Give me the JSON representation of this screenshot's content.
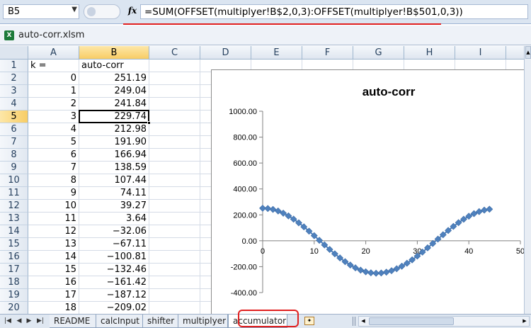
{
  "formula_bar": {
    "name_box": "B5",
    "fx_label": "fx",
    "formula": "=SUM(OFFSET(multiplyer!B$2,0,3):OFFSET(multiplyer!B$501,0,3))"
  },
  "workbook": {
    "title": "auto-corr.xlsm"
  },
  "columns": [
    "A",
    "B",
    "C",
    "D",
    "E",
    "F",
    "G",
    "H",
    "I"
  ],
  "selected": {
    "column": "B",
    "row": "5"
  },
  "header_row": {
    "row": "1",
    "a": "k =",
    "b": "auto-corr"
  },
  "rows": [
    {
      "row": "2",
      "k": "0",
      "v": "251.19"
    },
    {
      "row": "3",
      "k": "1",
      "v": "249.04"
    },
    {
      "row": "4",
      "k": "2",
      "v": "241.84"
    },
    {
      "row": "5",
      "k": "3",
      "v": "229.74"
    },
    {
      "row": "6",
      "k": "4",
      "v": "212.98"
    },
    {
      "row": "7",
      "k": "5",
      "v": "191.90"
    },
    {
      "row": "8",
      "k": "6",
      "v": "166.94"
    },
    {
      "row": "9",
      "k": "7",
      "v": "138.59"
    },
    {
      "row": "10",
      "k": "8",
      "v": "107.44"
    },
    {
      "row": "11",
      "k": "9",
      "v": "74.11"
    },
    {
      "row": "12",
      "k": "10",
      "v": "39.27"
    },
    {
      "row": "13",
      "k": "11",
      "v": "3.64"
    },
    {
      "row": "14",
      "k": "12",
      "v": "−32.06"
    },
    {
      "row": "15",
      "k": "13",
      "v": "−67.11"
    },
    {
      "row": "16",
      "k": "14",
      "v": "−100.81"
    },
    {
      "row": "17",
      "k": "15",
      "v": "−132.46"
    },
    {
      "row": "18",
      "k": "16",
      "v": "−161.42"
    },
    {
      "row": "19",
      "k": "17",
      "v": "−187.12"
    },
    {
      "row": "20",
      "k": "18",
      "v": "−209.02"
    }
  ],
  "sheet_tabs": [
    {
      "label": "README",
      "active": false
    },
    {
      "label": "calcInput",
      "active": false
    },
    {
      "label": "shifter",
      "active": false
    },
    {
      "label": "multiplyer",
      "active": false
    },
    {
      "label": "accumulator",
      "active": true
    }
  ],
  "accent_colors": {
    "highlight_red": "#e02020",
    "series_blue": "#4f81bd"
  },
  "chart_data": {
    "type": "scatter",
    "title": "auto-corr",
    "xlabel": "",
    "ylabel": "",
    "xlim": [
      0,
      50
    ],
    "ylim": [
      -400,
      1000
    ],
    "x_ticks": [
      "0",
      "10",
      "20",
      "30",
      "40",
      "50"
    ],
    "y_ticks": [
      "1000.00",
      "800.00",
      "600.00",
      "400.00",
      "200.00",
      "0.00",
      "-200.00",
      "-400.00"
    ],
    "series": [
      {
        "marker": "diamond",
        "color": "#4f81bd",
        "x": [
          0,
          1,
          2,
          3,
          4,
          5,
          6,
          7,
          8,
          9,
          10,
          11,
          12,
          13,
          14,
          15,
          16,
          17,
          18,
          19,
          20,
          21,
          22,
          23,
          24,
          25,
          26,
          27,
          28,
          29,
          30,
          31,
          32,
          33,
          34,
          35,
          36,
          37,
          38,
          39,
          40,
          41,
          42,
          43,
          44
        ],
        "values": [
          251.19,
          249.04,
          241.84,
          229.74,
          212.98,
          191.9,
          166.94,
          138.59,
          107.44,
          74.11,
          39.27,
          3.64,
          -32.06,
          -67.11,
          -100.81,
          -132.46,
          -161.42,
          -187.12,
          -209.02,
          -226.6,
          -239.5,
          -247.6,
          -250.7,
          -248.9,
          -242.3,
          -231.2,
          -215.8,
          -196.4,
          -173.4,
          -147.2,
          -118.3,
          -87.3,
          -54.7,
          -21.1,
          12.9,
          46.6,
          79.4,
          110.6,
          139.7,
          166.2,
          189.5,
          209.3,
          225.1,
          236.7,
          243.8
        ]
      }
    ]
  }
}
